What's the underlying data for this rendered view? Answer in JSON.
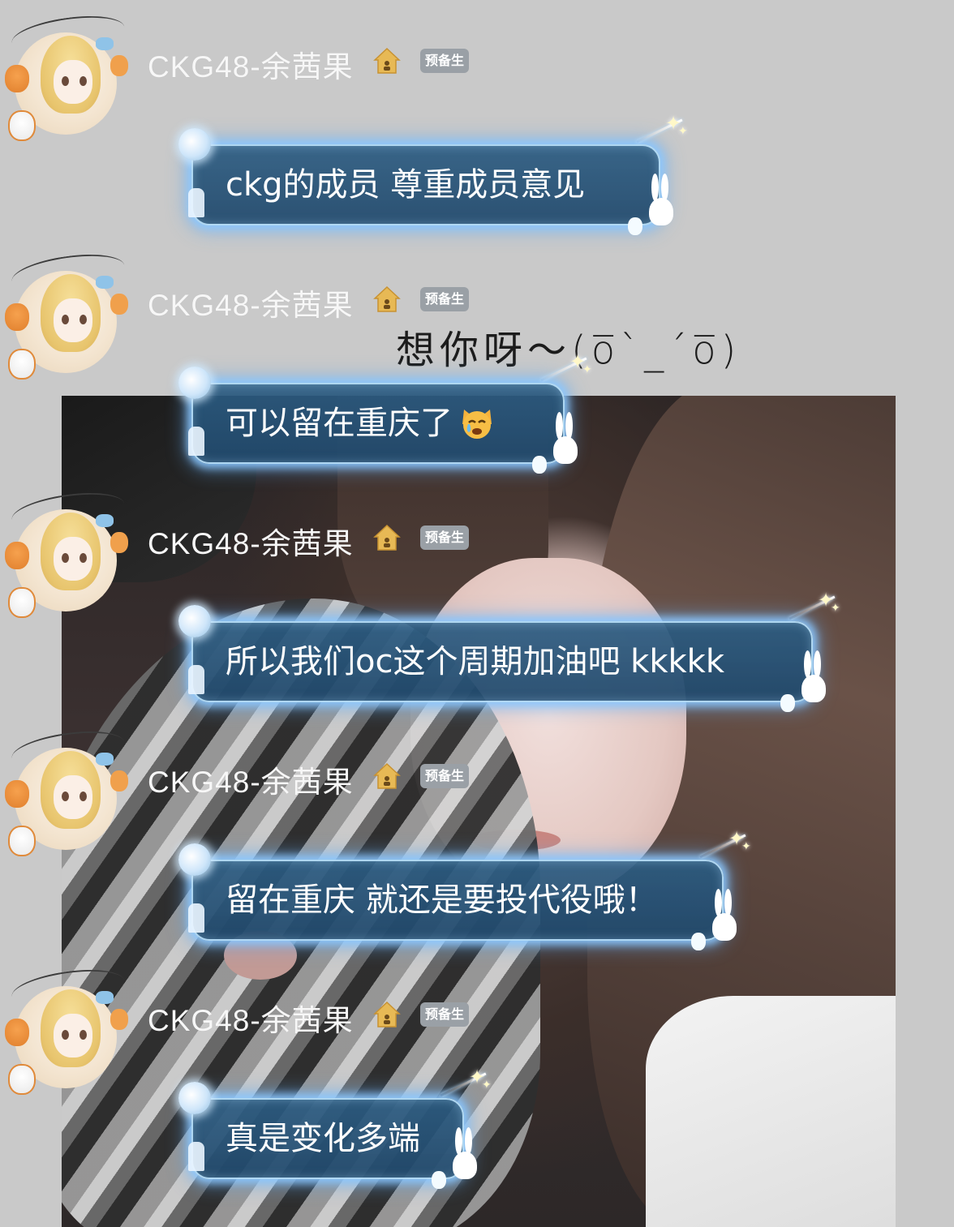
{
  "messages": [
    {
      "sender": "CKG48-余茜果",
      "badge": "预备生",
      "text": "ckg的成员 尊重成员意见"
    },
    {
      "sender": "CKG48-余茜果",
      "badge": "预备生",
      "text": "可以留在重庆了",
      "emoji": "crying-cat-face"
    },
    {
      "sender": "CKG48-余茜果",
      "badge": "预备生",
      "text": "所以我们oc这个周期加油吧 kkkkk"
    },
    {
      "sender": "CKG48-余茜果",
      "badge": "预备生",
      "text": "留在重庆 就还是要投代役哦！"
    },
    {
      "sender": "CKG48-余茜果",
      "badge": "预备生",
      "text": "真是变化多端"
    }
  ],
  "overlay": {
    "handwriting": "想你呀～(o̅ˋ_ˊo̅)"
  },
  "colors": {
    "background": "#c9c9c9",
    "bubble": "#2c5c82",
    "bubble_glow": "#8cc8ff",
    "badge": "#9aa0a6",
    "name_text": "#f7f7f7",
    "house_icon": "#e0b24a"
  }
}
